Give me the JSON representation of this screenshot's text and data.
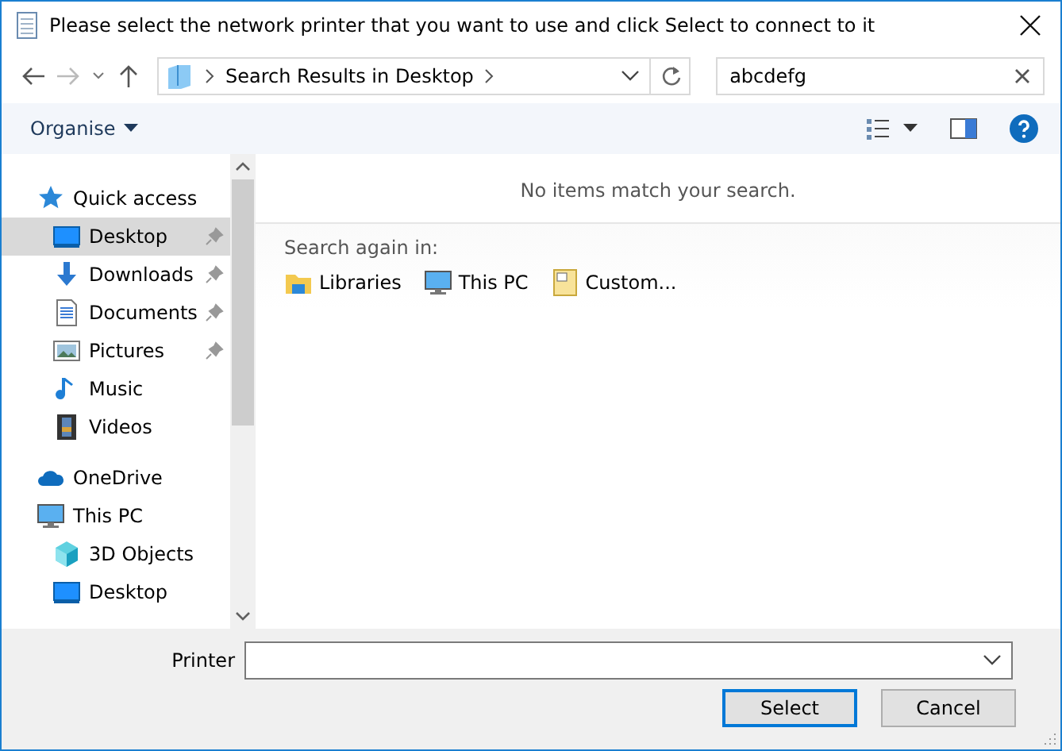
{
  "window": {
    "title": "Please select the network printer that you want to use and click Select to connect to it"
  },
  "address_bar": {
    "path": "Search Results in Desktop"
  },
  "search": {
    "value": "abcdefg"
  },
  "toolbar": {
    "organise": "Organise"
  },
  "sidebar": {
    "items": [
      {
        "label": "Quick access",
        "kind": "star",
        "children": [
          {
            "label": "Desktop",
            "kind": "desktop",
            "selected": true,
            "pinned": true
          },
          {
            "label": "Downloads",
            "kind": "download",
            "selected": false,
            "pinned": true
          },
          {
            "label": "Documents",
            "kind": "document",
            "selected": false,
            "pinned": true
          },
          {
            "label": "Pictures",
            "kind": "pictures",
            "selected": false,
            "pinned": true
          },
          {
            "label": "Music",
            "kind": "music",
            "selected": false,
            "pinned": false
          },
          {
            "label": "Videos",
            "kind": "videos",
            "selected": false,
            "pinned": false
          }
        ]
      },
      {
        "label": "OneDrive",
        "kind": "cloud"
      },
      {
        "label": "This PC",
        "kind": "pc",
        "children": [
          {
            "label": "3D Objects",
            "kind": "cube",
            "selected": false,
            "pinned": false
          },
          {
            "label": "Desktop",
            "kind": "desktop",
            "selected": false,
            "pinned": false
          }
        ]
      }
    ]
  },
  "content": {
    "message": "No items match your search.",
    "search_again_label": "Search again in:",
    "locations": [
      {
        "label": "Libraries",
        "kind": "libraries"
      },
      {
        "label": "This PC",
        "kind": "pc"
      },
      {
        "label": "Custom...",
        "kind": "custom"
      }
    ]
  },
  "footer": {
    "printer_label": "Printer",
    "buttons": [
      {
        "label": "Select",
        "default": true
      },
      {
        "label": "Cancel",
        "default": false
      }
    ]
  }
}
